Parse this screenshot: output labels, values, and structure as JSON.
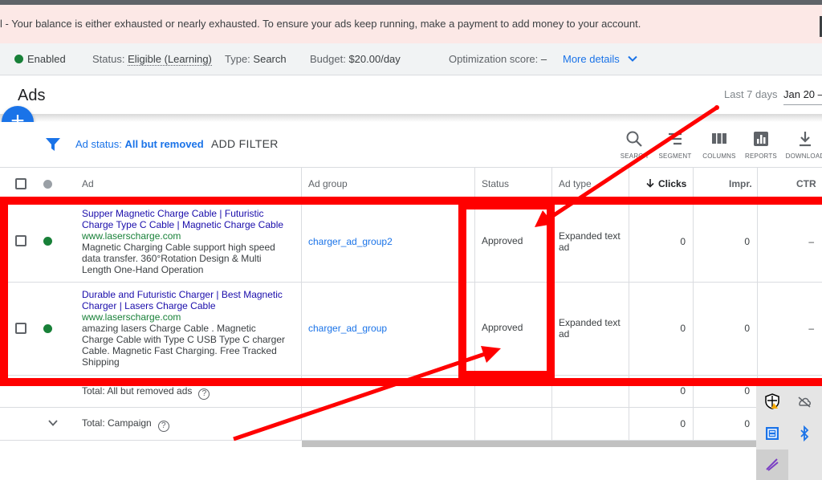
{
  "alert": {
    "text": "l - Your balance is either exhausted or nearly exhausted. To ensure your ads keep running, make a payment to add money to your account."
  },
  "campaign_status": {
    "enabled_label": "Enabled",
    "status_label": "Status:",
    "status_value": "Eligible (Learning)",
    "type_label": "Type:",
    "type_value": "Search",
    "budget_label": "Budget:",
    "budget_value": "$20.00/day",
    "optimization_label": "Optimization score:",
    "optimization_value": "–",
    "more_details": "More details"
  },
  "page": {
    "title": "Ads",
    "date_range_label": "Last 7 days",
    "date_range_value": "Jan 20 –"
  },
  "filter": {
    "ad_status_label": "Ad status:",
    "ad_status_value": "All but removed",
    "add_filter": "ADD FILTER"
  },
  "toolbar": {
    "search": "SEARCH",
    "segment": "SEGMENT",
    "columns": "COLUMNS",
    "reports": "REPORTS",
    "download": "DOWNLOAD"
  },
  "table": {
    "headers": {
      "ad": "Ad",
      "ad_group": "Ad group",
      "status": "Status",
      "ad_type": "Ad type",
      "clicks": "Clicks",
      "impr": "Impr.",
      "ctr": "CTR"
    },
    "rows": [
      {
        "headline_1": "Supper Magnetic Charge Cable | Futuristic",
        "headline_2": "Charge Type C Cable | Magnetic Charge Cable",
        "url": "www.laserscharge.com",
        "desc_1": "Magnetic Charging Cable support high speed",
        "desc_2": "data transfer. 360°Rotation Design & Multi",
        "desc_3": "Length One-Hand Operation",
        "desc_4": "",
        "ad_group": "charger_ad_group2",
        "status": "Approved",
        "ad_type_1": "Expanded text",
        "ad_type_2": "ad",
        "clicks": "0",
        "impr": "0",
        "ctr": "–"
      },
      {
        "headline_1": "Durable and Futuristic Charger | Best Magnetic",
        "headline_2": "Charger | Lasers Charge Cable",
        "url": "www.laserscharge.com",
        "desc_1": "amazing lasers Charge Cable . Magnetic",
        "desc_2": "Charge Cable with Type C USB Type C charger",
        "desc_3": "Cable. Magnetic Fast Charging. Free Tracked",
        "desc_4": "Shipping",
        "ad_group": "charger_ad_group",
        "status": "Approved",
        "ad_type_1": "Expanded text",
        "ad_type_2": "ad",
        "clicks": "0",
        "impr": "0",
        "ctr": "–"
      }
    ],
    "totals": {
      "all_but_removed_label": "Total: All but removed ads",
      "all_but_removed_clicks": "0",
      "all_but_removed_impr": "0",
      "campaign_label": "Total: Campaign",
      "campaign_clicks": "0",
      "campaign_impr": "0"
    }
  },
  "colors": {
    "annotation_red": "#ff0000",
    "brand_blue": "#1a73e8",
    "enabled_green": "#188038",
    "alert_background": "#fce8e6"
  }
}
